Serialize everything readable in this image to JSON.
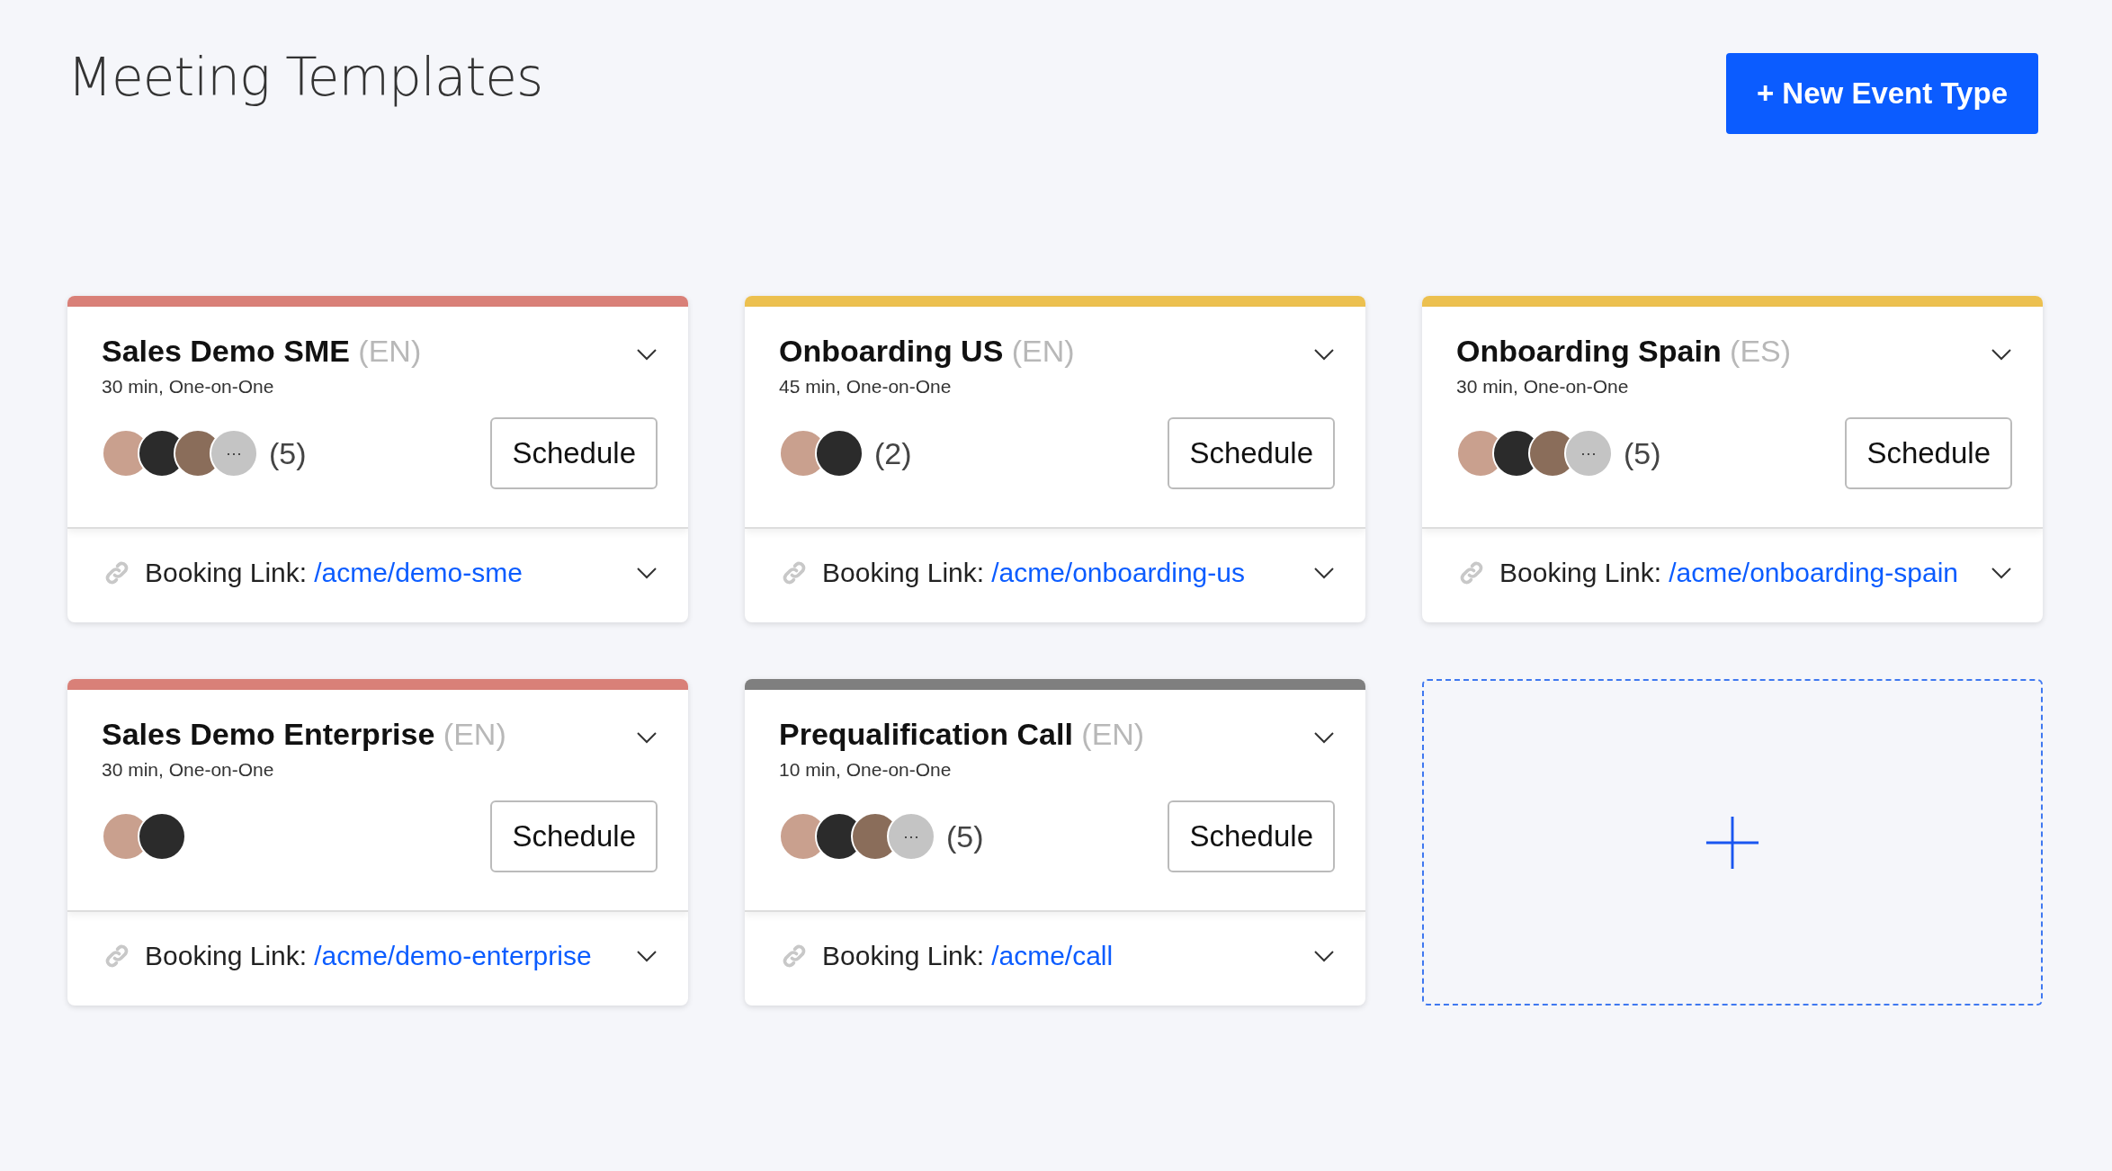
{
  "page": {
    "title": "Meeting Templates"
  },
  "new_button": {
    "label": "+ New Event Type"
  },
  "cards": [
    {
      "color": "#d98078",
      "title": "Sales Demo SME",
      "language": "(EN)",
      "details": "30 min, One-on-One",
      "avatars": [
        {
          "kind": "photo"
        },
        {
          "kind": "photo"
        },
        {
          "kind": "photo"
        },
        {
          "kind": "more",
          "label": "···"
        }
      ],
      "count": "(5)",
      "button": "Schedule",
      "link_label": "Booking Link:",
      "link": "/acme/demo-sme"
    },
    {
      "color": "#ecc04f",
      "title": "Onboarding US",
      "language": "(EN)",
      "details": "45 min, One-on-One",
      "avatars": [
        {
          "kind": "photo"
        },
        {
          "kind": "photo"
        }
      ],
      "count": "(2)",
      "button": "Schedule",
      "link_label": "Booking Link:",
      "link": "/acme/onboarding-us"
    },
    {
      "color": "#ecc04f",
      "title": "Onboarding Spain",
      "language": "(ES)",
      "details": "30 min, One-on-One",
      "avatars": [
        {
          "kind": "photo"
        },
        {
          "kind": "photo"
        },
        {
          "kind": "photo"
        },
        {
          "kind": "more",
          "label": "···"
        }
      ],
      "count": "(5)",
      "button": "Schedule",
      "link_label": "Booking Link:",
      "link": "/acme/onboarding-spain"
    },
    {
      "color": "#d98078",
      "title": "Sales Demo Enterprise",
      "language": "(EN)",
      "details": "30 min, One-on-One",
      "avatars": [
        {
          "kind": "photo"
        },
        {
          "kind": "photo"
        }
      ],
      "button": "Schedule",
      "link_label": "Booking Link:",
      "link": "/acme/demo-enterprise"
    },
    {
      "color": "#7f7f7f",
      "title": "Prequalification Call",
      "language": "(EN)",
      "details": "10 min, One-on-One",
      "avatars": [
        {
          "kind": "photo"
        },
        {
          "kind": "photo"
        },
        {
          "kind": "photo"
        },
        {
          "kind": "more",
          "label": "···"
        }
      ],
      "count": "(5)",
      "button": "Schedule",
      "link_label": "Booking Link:",
      "link": "/acme/call"
    }
  ]
}
